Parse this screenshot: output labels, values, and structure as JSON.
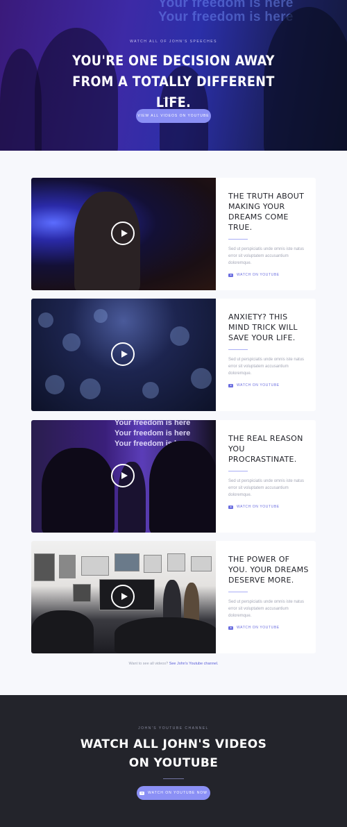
{
  "hero": {
    "watermark_lines": [
      "Your freedom is here",
      "Your freedom is here"
    ],
    "eyebrow": "Watch all of John's speeches",
    "title": "You're one decision away from a totally different life.",
    "button_label": "View all videos on YouTube"
  },
  "videos": [
    {
      "title": "The truth about making your dreams come true.",
      "description": "Sed ut perspiciatis unde omnis iste natus error sit voluptatem accusantium doloremque.",
      "link_label": "Watch on YouTube"
    },
    {
      "title": "Anxiety? This mind trick will save your life.",
      "description": "Sed ut perspiciatis unde omnis iste natus error sit voluptatem accusantium doloremque.",
      "link_label": "Watch on YouTube"
    },
    {
      "title": "The real reason you procrastinate.",
      "description": "Sed ut perspiciatis unde omnis iste natus error sit voluptatem accusantium doloremque.",
      "link_label": "Watch on YouTube",
      "thumbnail_text": [
        "Your freedom is here",
        "Your freedom is here",
        "Your freedom is here"
      ]
    },
    {
      "title": "The power of you. Your dreams deserve more.",
      "description": "Sed ut perspiciatis unde omnis iste natus error sit voluptatem accusantium doloremque.",
      "link_label": "Watch on YouTube"
    }
  ],
  "see_all": {
    "prefix": "Want to see all videos?",
    "link": "See John's Youtube channel."
  },
  "cta": {
    "eyebrow": "John's YouTube channel",
    "title": "Watch all John's videos on YouTube",
    "button_label": "Watch on YouTube now"
  },
  "colors": {
    "accent": "#8b90f5",
    "link": "#6c6fe0",
    "dark_bg": "#23242b",
    "page_bg": "#f7f8fc"
  },
  "icons": {
    "play": "play-icon",
    "youtube": "youtube-icon"
  }
}
